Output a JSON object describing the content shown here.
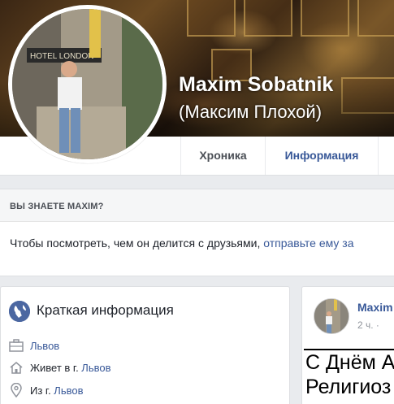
{
  "profile": {
    "name": "Maxim Sobatnik",
    "alternate_name": "(Максим Плохой)"
  },
  "tabs": [
    {
      "label": "Хроника"
    },
    {
      "label": "Информация"
    }
  ],
  "do_you_know": {
    "heading": "ВЫ ЗНАЕТЕ MAXIM?",
    "text": "Чтобы посмотреть, чем он делится с друзьями, ",
    "link": "отправьте ему за"
  },
  "intro": {
    "title": "Краткая информация",
    "items": [
      {
        "icon": "briefcase-icon",
        "prefix": "",
        "link": "Львов"
      },
      {
        "icon": "home-icon",
        "prefix": "Живет в г. ",
        "link": "Львов"
      },
      {
        "icon": "location-pin-icon",
        "prefix": "Из г. ",
        "link": "Львов"
      }
    ]
  },
  "post": {
    "author": "Maxim",
    "time": "2 ч. ·",
    "image_text": "С Днём А\nРелигиоз"
  },
  "colors": {
    "link": "#385898",
    "background": "#e9ebee"
  }
}
